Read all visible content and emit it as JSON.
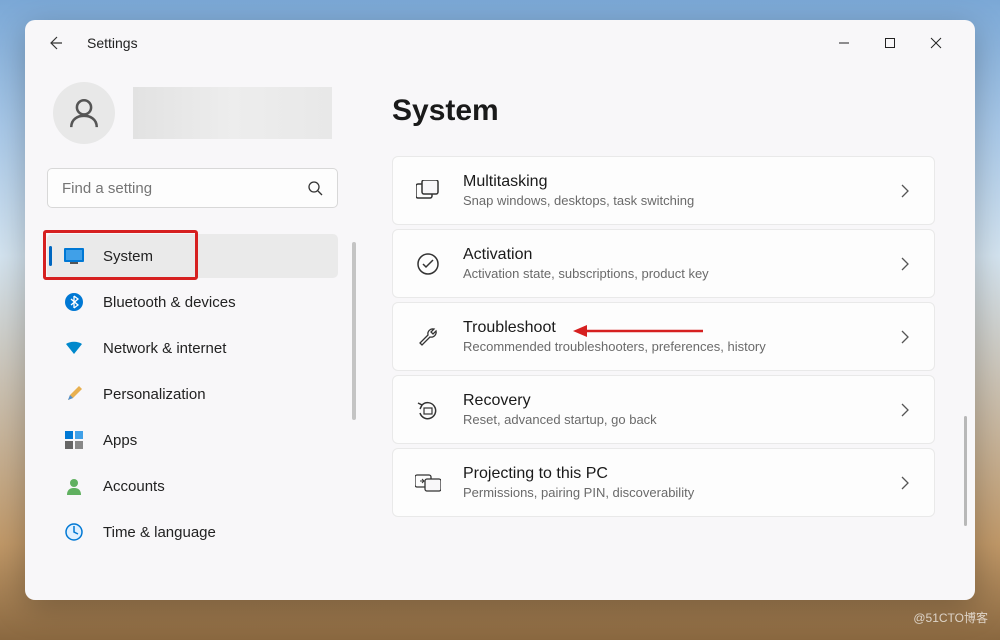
{
  "window": {
    "title": "Settings"
  },
  "search": {
    "placeholder": "Find a setting"
  },
  "nav": {
    "items": [
      {
        "label": "System"
      },
      {
        "label": "Bluetooth & devices"
      },
      {
        "label": "Network & internet"
      },
      {
        "label": "Personalization"
      },
      {
        "label": "Apps"
      },
      {
        "label": "Accounts"
      },
      {
        "label": "Time & language"
      }
    ]
  },
  "page": {
    "title": "System"
  },
  "cards": [
    {
      "title": "Multitasking",
      "desc": "Snap windows, desktops, task switching"
    },
    {
      "title": "Activation",
      "desc": "Activation state, subscriptions, product key"
    },
    {
      "title": "Troubleshoot",
      "desc": "Recommended troubleshooters, preferences, history"
    },
    {
      "title": "Recovery",
      "desc": "Reset, advanced startup, go back"
    },
    {
      "title": "Projecting to this PC",
      "desc": "Permissions, pairing PIN, discoverability"
    }
  ],
  "watermark": "@51CTO博客"
}
